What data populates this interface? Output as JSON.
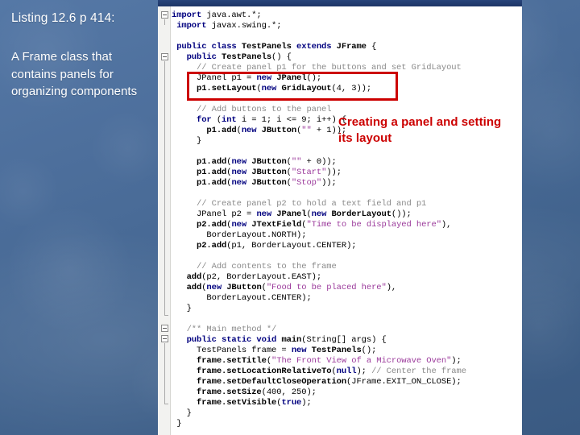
{
  "slide": {
    "background_color": "#4a6d99",
    "title": "Listing 12.6 p 414:",
    "description": "A Frame class that contains panels for organizing components"
  },
  "callout": {
    "text": "Creating a panel and setting its layout",
    "color": "#cc0000"
  },
  "editor": {
    "titlebar_color": "#28447a",
    "gutter_color": "#f2f2f0",
    "background_color": "#ffffff",
    "highlight_border_color": "#cc0000",
    "code_lines": [
      "import java.awt.*;",
      "import javax.swing.*;",
      "",
      "public class TestPanels extends JFrame {",
      "  public TestPanels() {",
      "    // Create panel p1 for the buttons and set GridLayout",
      "    JPanel p1 = new JPanel();",
      "    p1.setLayout(new GridLayout(4, 3));",
      "",
      "    // Add buttons to the panel",
      "    for (int i = 1; i <= 9; i++) {",
      "      p1.add(new JButton(\"\" + i));",
      "    }",
      "",
      "    p1.add(new JButton(\"\" + 0));",
      "    p1.add(new JButton(\"Start\"));",
      "    p1.add(new JButton(\"Stop\"));",
      "",
      "    // Create panel p2 to hold a text field and p1",
      "    JPanel p2 = new JPanel(new BorderLayout());",
      "    p2.add(new JTextField(\"Time to be displayed here\"),",
      "      BorderLayout.NORTH);",
      "    p2.add(p1, BorderLayout.CENTER);",
      "",
      "    // Add contents to the frame",
      "    add(p2, BorderLayout.EAST);",
      "    add(new JButton(\"Food to be placed here\"),",
      "      BorderLayout.CENTER);",
      "  }",
      "",
      "  /** Main method */",
      "  public static void main(String[] args) {",
      "    TestPanels frame = new TestPanels();",
      "    frame.setTitle(\"The Front View of a Microwave Oven\");",
      "    frame.setLocationRelativeTo(null); // Center the frame",
      "    frame.setDefaultCloseOperation(JFrame.EXIT_ON_CLOSE);",
      "    frame.setSize(400, 250);",
      "    frame.setVisible(true);",
      "  }",
      "}"
    ],
    "highlighted_lines": [
      "JPanel p1 = new JPanel();",
      "p1.setLayout(new GridLayout(4, 3));"
    ]
  }
}
